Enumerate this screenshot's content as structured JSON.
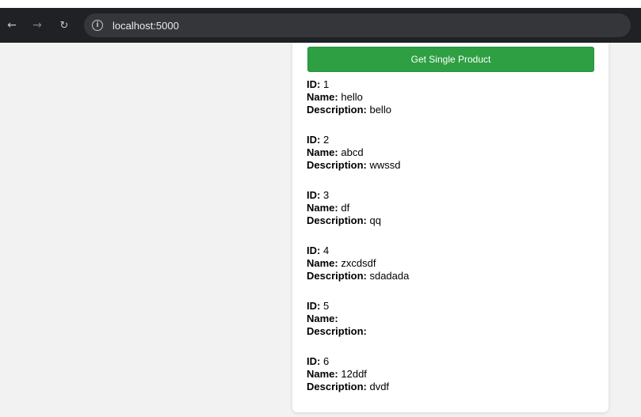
{
  "browser": {
    "url": "localhost:5000"
  },
  "page": {
    "get_single_label": "Get Single Product",
    "field_labels": {
      "id": "ID:",
      "name": "Name:",
      "description": "Description:"
    },
    "products": [
      {
        "id": "1",
        "name": "hello",
        "description": "bello"
      },
      {
        "id": "2",
        "name": "abcd",
        "description": "wwssd"
      },
      {
        "id": "3",
        "name": "df",
        "description": "qq"
      },
      {
        "id": "4",
        "name": "zxcdsdf",
        "description": "sdadada"
      },
      {
        "id": "5",
        "name": "",
        "description": ""
      },
      {
        "id": "6",
        "name": "12ddf",
        "description": "dvdf"
      }
    ]
  }
}
